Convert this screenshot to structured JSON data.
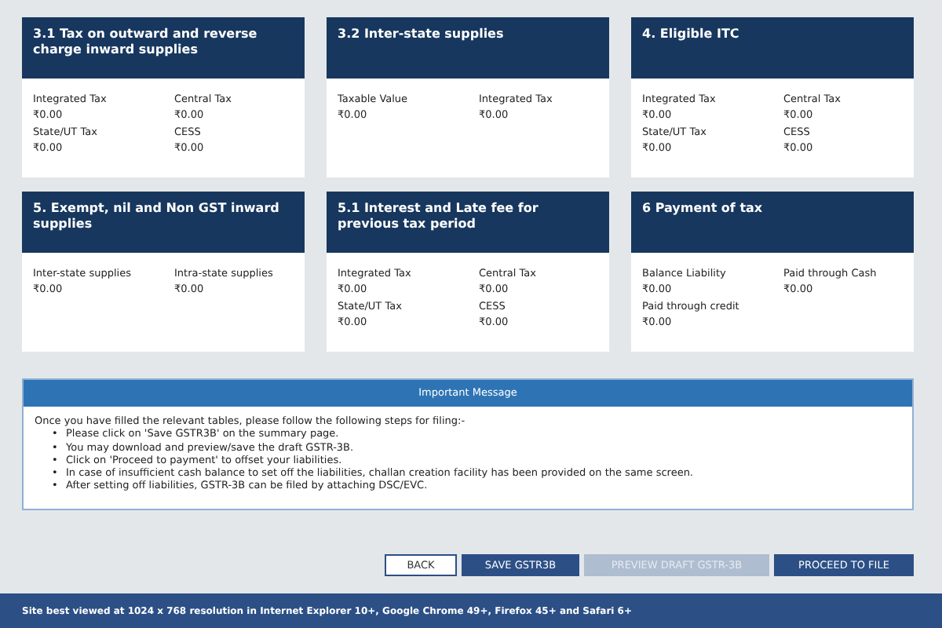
{
  "cards": [
    {
      "title": "3.1 Tax on outward and reverse charge inward supplies",
      "fields": [
        {
          "label": "Integrated Tax",
          "value": "₹0.00"
        },
        {
          "label": "Central Tax",
          "value": "₹0.00"
        },
        {
          "label": "State/UT Tax",
          "value": "₹0.00"
        },
        {
          "label": "CESS",
          "value": "₹0.00"
        }
      ]
    },
    {
      "title": "3.2 Inter-state supplies",
      "fields": [
        {
          "label": "Taxable Value",
          "value": "₹0.00"
        },
        {
          "label": "Integrated Tax",
          "value": "₹0.00"
        }
      ]
    },
    {
      "title": "4. Eligible ITC",
      "fields": [
        {
          "label": "Integrated Tax",
          "value": "₹0.00"
        },
        {
          "label": "Central Tax",
          "value": "₹0.00"
        },
        {
          "label": "State/UT Tax",
          "value": "₹0.00"
        },
        {
          "label": "CESS",
          "value": "₹0.00"
        }
      ]
    },
    {
      "title": "5. Exempt, nil and Non GST inward supplies",
      "fields": [
        {
          "label": "Inter-state supplies",
          "value": "₹0.00"
        },
        {
          "label": "Intra-state supplies",
          "value": "₹0.00"
        }
      ]
    },
    {
      "title": "5.1 Interest and Late fee for previous tax period",
      "fields": [
        {
          "label": "Integrated Tax",
          "value": "₹0.00"
        },
        {
          "label": "Central Tax",
          "value": "₹0.00"
        },
        {
          "label": "State/UT Tax",
          "value": "₹0.00"
        },
        {
          "label": "CESS",
          "value": "₹0.00"
        }
      ]
    },
    {
      "title": "6 Payment of tax",
      "fields": [
        {
          "label": "Balance Liability",
          "value": "₹0.00"
        },
        {
          "label": "Paid through Cash",
          "value": "₹0.00"
        },
        {
          "label": "Paid through credit",
          "value": "₹0.00"
        }
      ]
    }
  ],
  "message": {
    "title": "Important Message",
    "intro": "Once you have filled the relevant tables, please follow the following steps for filing:-",
    "steps": [
      {
        "bullet": "•",
        "text": "Please click on 'Save GSTR3B' on the summary page."
      },
      {
        "bullet": "•",
        "text": "You may download and preview/save the draft GSTR-3B."
      },
      {
        "bullet": "•",
        "text": "Click on 'Proceed to payment' to offset your liabilities."
      },
      {
        "bullet": "•",
        "text": "In case of insufficient cash balance to set off the liabilities, challan creation facility has been provided on the same screen."
      },
      {
        "bullet": "•",
        "text": "After setting off liabilities, GSTR-3B can be filed by attaching DSC/EVC."
      }
    ]
  },
  "buttons": [
    {
      "label": "BACK",
      "kind": "outline",
      "disabled": false
    },
    {
      "label": "SAVE GSTR3B",
      "kind": "primary",
      "disabled": false
    },
    {
      "label": "PREVIEW DRAFT GSTR-3B",
      "kind": "primary",
      "disabled": true
    },
    {
      "label": "PROCEED TO FILE",
      "kind": "primary",
      "disabled": false
    }
  ],
  "footer": "Site best viewed at 1024 x 768 resolution in Internet Explorer 10+, Google Chrome 49+, Firefox 45+ and Safari 6+"
}
